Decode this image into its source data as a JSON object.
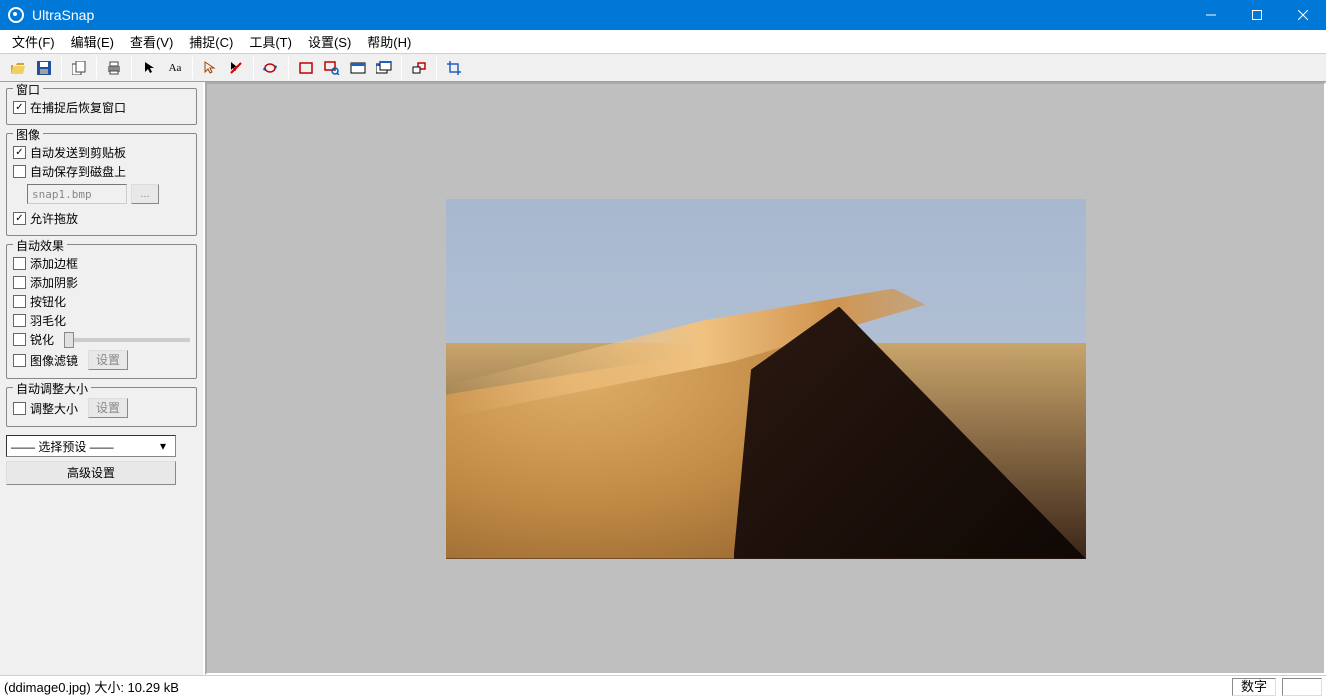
{
  "app": {
    "title": "UltraSnap"
  },
  "menu": {
    "file": "文件(F)",
    "edit": "编辑(E)",
    "view": "查看(V)",
    "capture": "捕捉(C)",
    "tools": "工具(T)",
    "settings": "设置(S)",
    "help": "帮助(H)"
  },
  "sidebar": {
    "window": {
      "legend": "窗口",
      "restore_after_capture": "在捕捉后恢复窗口"
    },
    "image": {
      "legend": "图像",
      "auto_clipboard": "自动发送到剪贴板",
      "auto_save_disk": "自动保存到磁盘上",
      "filename": "snap1.bmp",
      "browse": "...",
      "allow_drag": "允许拖放"
    },
    "effects": {
      "legend": "自动效果",
      "add_border": "添加边框",
      "add_shadow": "添加阴影",
      "buttonize": "按钮化",
      "feather": "羽毛化",
      "sharpen": "锐化",
      "filter": "图像滤镜",
      "set_btn": "设置"
    },
    "resize": {
      "legend": "自动调整大小",
      "resize": "调整大小",
      "set_btn": "设置"
    },
    "preset_select": "——  选择预设  ——",
    "advanced_btn": "高级设置"
  },
  "status": {
    "left": "(ddimage0.jpg) 大小: 10.29 kB",
    "numlock": "数字"
  }
}
